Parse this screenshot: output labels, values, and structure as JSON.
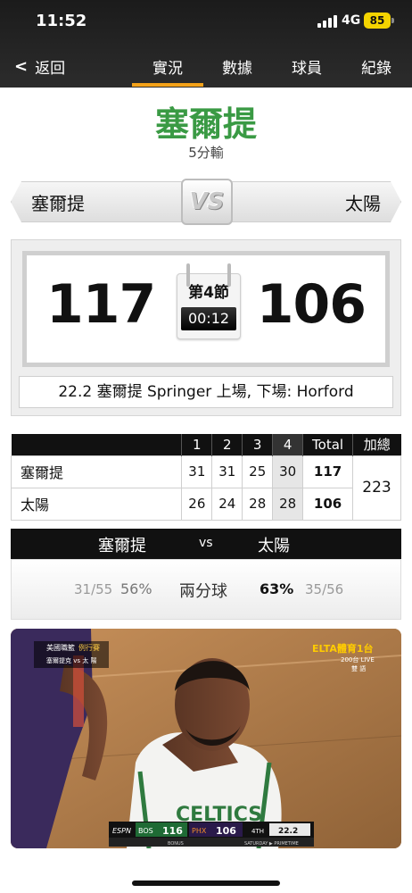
{
  "status_bar": {
    "time": "11:52",
    "network": "4G",
    "battery": "85"
  },
  "nav": {
    "back_label": "返回",
    "tabs": [
      {
        "label": "實況",
        "active": true
      },
      {
        "label": "數據",
        "active": false
      },
      {
        "label": "球員",
        "active": false
      },
      {
        "label": "紀錄",
        "active": false
      }
    ]
  },
  "game": {
    "title_team": "塞爾提",
    "result_text": "5分輸",
    "home_team": "塞爾提",
    "away_team": "太陽",
    "vs_label": "VS",
    "home_score": "117",
    "away_score": "106",
    "period": "第4節",
    "clock": "00:12",
    "last_event": "22.2 塞爾提 Springer 上場, 下場: Horford"
  },
  "quarter_table": {
    "headers": [
      "",
      "1",
      "2",
      "3",
      "4",
      "Total",
      "加總"
    ],
    "rows": [
      {
        "team": "塞爾提",
        "q": [
          "31",
          "31",
          "25",
          "30"
        ],
        "total": "117"
      },
      {
        "team": "太陽",
        "q": [
          "26",
          "24",
          "28",
          "28"
        ],
        "total": "106"
      }
    ],
    "combined": "223"
  },
  "stats": {
    "home_team": "塞爾提",
    "vs": "vs",
    "away_team": "太陽",
    "row": {
      "label": "兩分球",
      "home_made_att": "31/55",
      "home_pct": "56%",
      "away_pct": "63%",
      "away_made_att": "35/56"
    }
  },
  "video": {
    "league_tag": "美國職籃",
    "event_tag": "例行賽",
    "matchup_tag": "塞爾提克 vs 太 陽",
    "channel": "ELTA體育1台",
    "channel_sub": "200台 LIVE",
    "channel_sub2": "雙 語",
    "scorebug": {
      "network": "ESPN",
      "home": "BOS",
      "home_score": "116",
      "away": "PHX",
      "away_score": "106",
      "quarter": "4TH",
      "clock": "22.2",
      "footer_left": "BONUS",
      "footer_right": "SATURDAY ▶ PRIMETIME"
    },
    "jersey_text": "CELTICS"
  }
}
